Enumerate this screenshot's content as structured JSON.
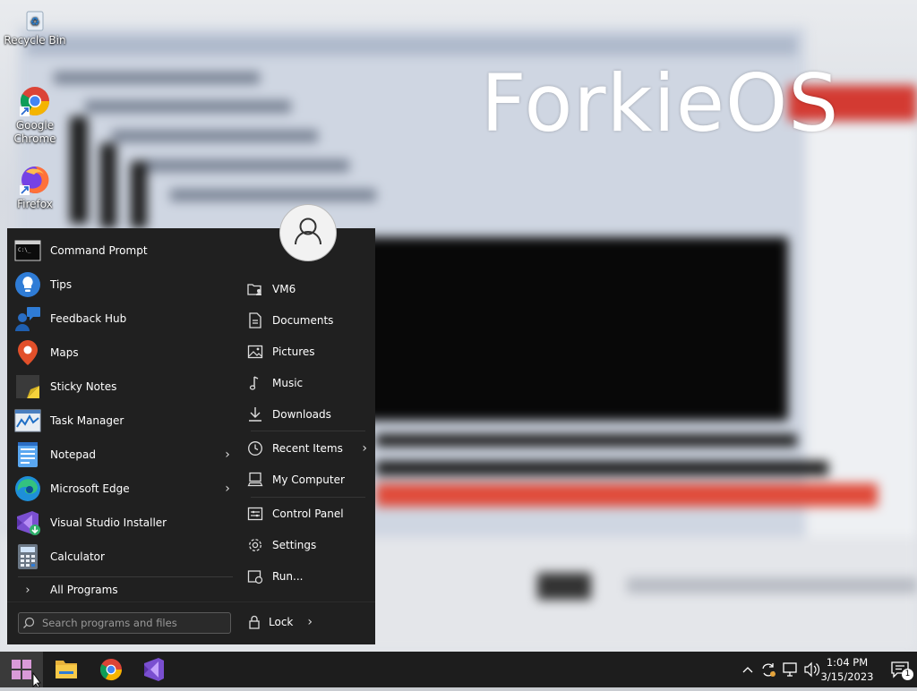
{
  "brand": {
    "text": "ForkieOS"
  },
  "desktop": {
    "icons": [
      {
        "label": "Recycle Bin",
        "icon": "recycle-bin-icon"
      },
      {
        "label": "Google Chrome",
        "icon": "chrome-icon"
      },
      {
        "label": "Firefox",
        "icon": "firefox-icon"
      }
    ]
  },
  "start_menu": {
    "apps": [
      {
        "label": "Command Prompt",
        "icon": "command-prompt-icon",
        "has_submenu": false
      },
      {
        "label": "Tips",
        "icon": "tips-icon",
        "has_submenu": false
      },
      {
        "label": "Feedback Hub",
        "icon": "feedback-hub-icon",
        "has_submenu": false
      },
      {
        "label": "Maps",
        "icon": "maps-icon",
        "has_submenu": false
      },
      {
        "label": "Sticky Notes",
        "icon": "sticky-notes-icon",
        "has_submenu": false
      },
      {
        "label": "Task Manager",
        "icon": "task-manager-icon",
        "has_submenu": false
      },
      {
        "label": "Notepad",
        "icon": "notepad-icon",
        "has_submenu": true
      },
      {
        "label": "Microsoft Edge",
        "icon": "edge-icon",
        "has_submenu": true
      },
      {
        "label": "Visual Studio Installer",
        "icon": "visual-studio-installer-icon",
        "has_submenu": false
      },
      {
        "label": "Calculator",
        "icon": "calculator-icon",
        "has_submenu": false
      }
    ],
    "all_programs_label": "All Programs",
    "search_placeholder": "Search programs and files",
    "places": [
      {
        "label": "VM6",
        "icon": "user-folder-icon"
      },
      {
        "label": "Documents",
        "icon": "document-icon"
      },
      {
        "label": "Pictures",
        "icon": "picture-icon"
      },
      {
        "label": "Music",
        "icon": "music-note-icon"
      },
      {
        "label": "Downloads",
        "icon": "download-icon"
      },
      {
        "label": "Recent Items",
        "icon": "clock-icon"
      },
      {
        "label": "My Computer",
        "icon": "computer-icon"
      },
      {
        "label": "Control Panel",
        "icon": "control-panel-icon"
      },
      {
        "label": "Settings",
        "icon": "gear-icon"
      },
      {
        "label": "Run...",
        "icon": "run-icon"
      }
    ],
    "lock_label": "Lock"
  },
  "taskbar": {
    "pinned": [
      {
        "name": "start-button",
        "icon": "windows-logo-icon"
      },
      {
        "name": "file-explorer",
        "icon": "folder-icon"
      },
      {
        "name": "google-chrome",
        "icon": "chrome-icon"
      },
      {
        "name": "visual-studio-installer",
        "icon": "visual-studio-icon"
      }
    ],
    "clock": {
      "time": "1:04 PM",
      "date": "3/15/2023"
    },
    "notification_count": "1"
  },
  "colors": {
    "menu_bg": "#202020",
    "taskbar_bg": "#1d1d1d",
    "accent_blue": "#2f7cd6"
  }
}
